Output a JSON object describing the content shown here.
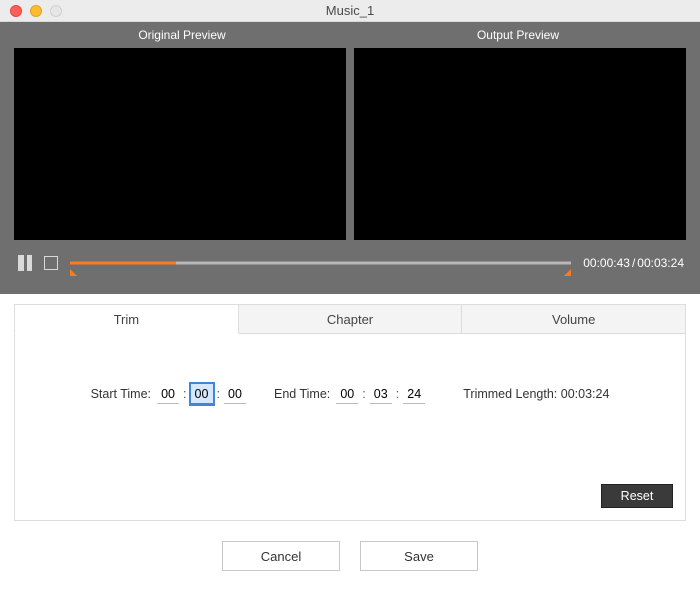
{
  "window": {
    "title": "Music_1"
  },
  "preview": {
    "original_label": "Original Preview",
    "output_label": "Output  Preview",
    "time_current": "00:00:43",
    "time_total": "00:03:24",
    "progress_percent": 21.1
  },
  "tabs": {
    "trim": "Trim",
    "chapter": "Chapter",
    "volume": "Volume",
    "active": "trim"
  },
  "trim": {
    "start_label": "Start Time:",
    "start_hh": "00",
    "start_mm": "00",
    "start_ss": "00",
    "end_label": "End Time:",
    "end_hh": "00",
    "end_mm": "03",
    "end_ss": "24",
    "trimmed_label": "Trimmed Length:",
    "trimmed_value": "00:03:24",
    "reset": "Reset"
  },
  "footer": {
    "cancel": "Cancel",
    "save": "Save"
  },
  "colors": {
    "accent": "#ff7a1c"
  }
}
